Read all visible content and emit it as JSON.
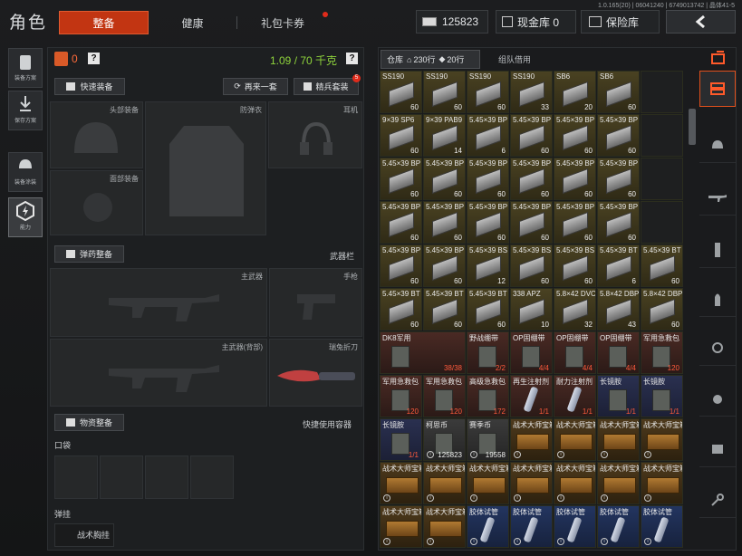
{
  "header": {
    "version": "1.0.165(20) | 06041240 | 6749013742 | 晶体41-5",
    "title": "角色",
    "tabs": [
      {
        "label": "整备"
      },
      {
        "label": "健康"
      },
      {
        "label": "礼包卡券"
      }
    ],
    "money": "125823",
    "cash_vault": "现金库 0",
    "safe": "保险库"
  },
  "left_nav": [
    {
      "label": "装备方案"
    },
    {
      "label": "保存方案"
    },
    {
      "label": "装备涂装"
    },
    {
      "label": "能力"
    }
  ],
  "loadout": {
    "bag_count": "0",
    "help": "?",
    "weight": "1.09 / 70 千克",
    "quick_equip": "快速装备",
    "again": "再来一套",
    "elite": "精兵套装",
    "elite_badge": "5",
    "slots": {
      "head": "头部装备",
      "armor": "防弹衣",
      "ears": "耳机",
      "face": "面部装备"
    },
    "ammo_section": "弹药整备",
    "weapon_bar": "武器栏",
    "primary": "主武器",
    "pistol": "手枪",
    "primary_back": "主武器(背部)",
    "knife": "瑞兔折刀",
    "supplies": "物资整备",
    "quick_container": "快捷使用容器",
    "pocket": "口袋",
    "rig": "弹挂",
    "chest_rig": "战术胸挂"
  },
  "warehouse": {
    "tab_storage": "仓库",
    "rows_a": "230行",
    "rows_b": "20行",
    "tab_team": "组队借用",
    "grid": [
      [
        {
          "n": "SS190",
          "c": "60"
        },
        {
          "n": "SS190",
          "c": "60"
        },
        {
          "n": "SS190",
          "c": "60"
        },
        {
          "n": "SS190",
          "c": "33"
        },
        {
          "n": "SB6",
          "c": "20"
        },
        {
          "n": "SB6",
          "c": "60"
        },
        {
          "n": "",
          "c": ""
        }
      ],
      [
        {
          "n": "9×39 SP6",
          "c": "60"
        },
        {
          "n": "9×39 PAB9",
          "c": "14"
        },
        {
          "n": "5.45×39 BP",
          "c": "6"
        },
        {
          "n": "5.45×39 BP",
          "c": "60"
        },
        {
          "n": "5.45×39 BP",
          "c": "60"
        },
        {
          "n": "5.45×39 BP",
          "c": "60"
        },
        {
          "n": "",
          "c": ""
        }
      ],
      [
        {
          "n": "5.45×39 BP",
          "c": "60"
        },
        {
          "n": "5.45×39 BP",
          "c": "60"
        },
        {
          "n": "5.45×39 BP",
          "c": "60"
        },
        {
          "n": "5.45×39 BP",
          "c": "60"
        },
        {
          "n": "5.45×39 BP",
          "c": "60"
        },
        {
          "n": "5.45×39 BP",
          "c": "60"
        },
        {
          "n": "",
          "c": ""
        }
      ],
      [
        {
          "n": "5.45×39 BP",
          "c": "60"
        },
        {
          "n": "5.45×39 BP",
          "c": "60"
        },
        {
          "n": "5.45×39 BP",
          "c": "60"
        },
        {
          "n": "5.45×39 BP",
          "c": "60"
        },
        {
          "n": "5.45×39 BP",
          "c": "60"
        },
        {
          "n": "5.45×39 BP",
          "c": "60"
        },
        {
          "n": "",
          "c": ""
        }
      ],
      [
        {
          "n": "5.45×39 BP",
          "c": "60"
        },
        {
          "n": "5.45×39 BP",
          "c": "60"
        },
        {
          "n": "5.45×39 BS",
          "c": "12"
        },
        {
          "n": "5.45×39 BS",
          "c": "60"
        },
        {
          "n": "5.45×39 BS",
          "c": "60"
        },
        {
          "n": "5.45×39 BT",
          "c": "6"
        },
        {
          "n": "5.45×39 BT",
          "c": "60"
        }
      ],
      [
        {
          "n": "5.45×39 BT",
          "c": "60"
        },
        {
          "n": "5.45×39 BT",
          "c": "60"
        },
        {
          "n": "5.45×39 BT",
          "c": "60"
        },
        {
          "n": "338 APZ",
          "c": "10"
        },
        {
          "n": "5.8×42 DVC12",
          "c": "32"
        },
        {
          "n": "5.8×42 DBP88",
          "c": "43"
        },
        {
          "n": "5.8×42 DBP88",
          "c": "60"
        }
      ],
      [
        {
          "n": "",
          "c": ""
        },
        {
          "n": "DK8军用",
          "c": "38/38"
        },
        {
          "n": "",
          "c": ""
        },
        {
          "n": "野战绷带",
          "c": "2/2"
        },
        {
          "n": "OP固绷带",
          "c": "4/4"
        },
        {
          "n": "OP固绷带",
          "c": "4/4"
        },
        {
          "n": "OP固绷带",
          "c": "4/4"
        },
        {
          "n": "军用急救包",
          "c": "120"
        }
      ],
      [
        {
          "n": "军用急救包",
          "c": "120"
        },
        {
          "n": "军用急救包",
          "c": "120"
        },
        {
          "n": "高级急救包",
          "c": "172"
        },
        {
          "n": "再生注射剂",
          "c": "1/1"
        },
        {
          "n": "耐力注射剂",
          "c": "1/1"
        },
        {
          "n": "长镜胺",
          "c": "1/1"
        },
        {
          "n": "长镜胺",
          "c": "1/1"
        }
      ],
      [
        {
          "n": "长镜胺",
          "c": "1/1"
        },
        {
          "n": "柯思币",
          "c": "125823"
        },
        {
          "n": "赛季币",
          "c": "19558"
        },
        {
          "n": "战术大师宝箱",
          "c": ""
        },
        {
          "n": "战术大师宝箱",
          "c": ""
        },
        {
          "n": "战术大师宝箱",
          "c": ""
        },
        {
          "n": "战术大师宝箱",
          "c": ""
        }
      ],
      [
        {
          "n": "战术大师宝箱",
          "c": ""
        },
        {
          "n": "战术大师宝箱",
          "c": ""
        },
        {
          "n": "战术大师宝箱",
          "c": ""
        },
        {
          "n": "战术大师宝箱",
          "c": ""
        },
        {
          "n": "战术大师宝箱",
          "c": ""
        },
        {
          "n": "战术大师宝箱",
          "c": ""
        },
        {
          "n": "战术大师宝箱",
          "c": ""
        }
      ],
      [
        {
          "n": "战术大师宝箱",
          "c": ""
        },
        {
          "n": "战术大师宝箱",
          "c": ""
        },
        {
          "n": "胶体试管",
          "c": ""
        },
        {
          "n": "胶体试管",
          "c": ""
        },
        {
          "n": "胶体试管",
          "c": ""
        },
        {
          "n": "胶体试管",
          "c": ""
        },
        {
          "n": "胶体试管",
          "c": ""
        }
      ]
    ]
  }
}
